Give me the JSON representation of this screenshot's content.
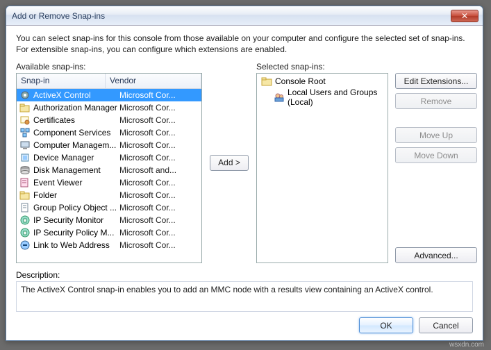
{
  "title": "Add or Remove Snap-ins",
  "intro": "You can select snap-ins for this console from those available on your computer and configure the selected set of snap-ins. For extensible snap-ins, you can configure which extensions are enabled.",
  "available_label": "Available snap-ins:",
  "selected_label": "Selected snap-ins:",
  "columns": {
    "snapin": "Snap-in",
    "vendor": "Vendor"
  },
  "available": [
    {
      "name": "ActiveX Control",
      "vendor": "Microsoft Cor...",
      "icon": "gear",
      "selected": true
    },
    {
      "name": "Authorization Manager",
      "vendor": "Microsoft Cor...",
      "icon": "folder"
    },
    {
      "name": "Certificates",
      "vendor": "Microsoft Cor...",
      "icon": "cert"
    },
    {
      "name": "Component Services",
      "vendor": "Microsoft Cor...",
      "icon": "component"
    },
    {
      "name": "Computer Managem...",
      "vendor": "Microsoft Cor...",
      "icon": "computer"
    },
    {
      "name": "Device Manager",
      "vendor": "Microsoft Cor...",
      "icon": "device"
    },
    {
      "name": "Disk Management",
      "vendor": "Microsoft and...",
      "icon": "disk"
    },
    {
      "name": "Event Viewer",
      "vendor": "Microsoft Cor...",
      "icon": "event"
    },
    {
      "name": "Folder",
      "vendor": "Microsoft Cor...",
      "icon": "folder"
    },
    {
      "name": "Group Policy Object ...",
      "vendor": "Microsoft Cor...",
      "icon": "doc"
    },
    {
      "name": "IP Security Monitor",
      "vendor": "Microsoft Cor...",
      "icon": "ipsec"
    },
    {
      "name": "IP Security Policy M...",
      "vendor": "Microsoft Cor...",
      "icon": "ipsec"
    },
    {
      "name": "Link to Web Address",
      "vendor": "Microsoft Cor...",
      "icon": "link"
    }
  ],
  "selected_root": "Console Root",
  "selected_items": [
    {
      "name": "Local Users and Groups (Local)",
      "icon": "users"
    }
  ],
  "buttons": {
    "edit_ext": "Edit Extensions...",
    "remove": "Remove",
    "move_up": "Move Up",
    "move_down": "Move Down",
    "advanced": "Advanced...",
    "add": "Add >",
    "ok": "OK",
    "cancel": "Cancel"
  },
  "description_label": "Description:",
  "description": "The ActiveX Control snap-in enables you to add an MMC node with a results view containing an ActiveX control.",
  "watermark": "wsxdn.com"
}
